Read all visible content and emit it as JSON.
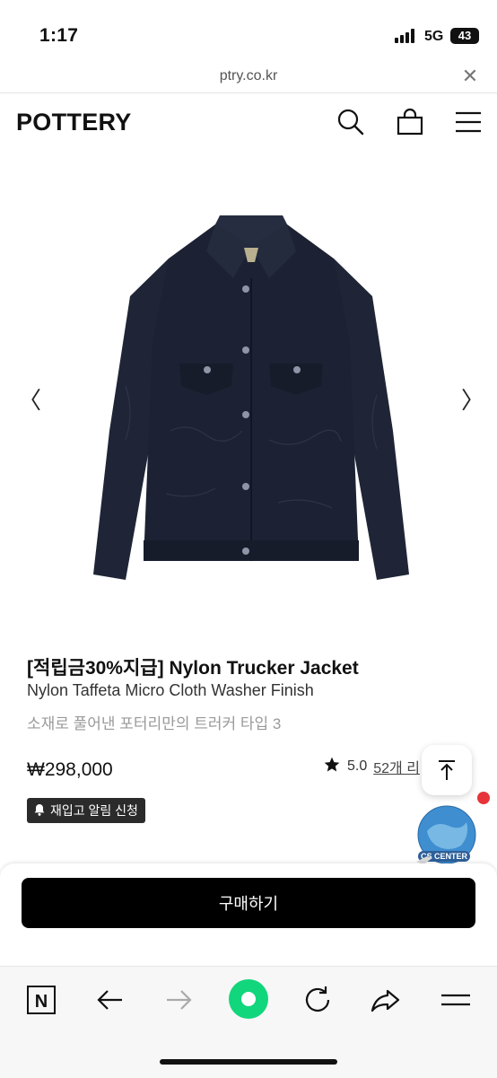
{
  "status_bar": {
    "time": "1:17",
    "network": "5G",
    "battery": "43"
  },
  "browser": {
    "url": "ptry.co.kr"
  },
  "site": {
    "logo": "POTTERY"
  },
  "header_icons": [
    "search-icon",
    "shopping-bag-icon",
    "menu-icon"
  ],
  "product": {
    "title": "[적립금30%지급] Nylon Trucker Jacket",
    "subtitle": "Nylon Taffeta Micro Cloth Washer Finish",
    "description": "소재로 풀어낸 포터리만의 트러커 타입 3",
    "price": "₩298,000",
    "rating": "5.0",
    "reviews": "52개 리",
    "restock_label": "재입고 알림 신청",
    "buy_label": "구매하기",
    "image_color": "#1c2233"
  },
  "carousel": {
    "prev_symbol": "〈",
    "next_symbol": "〉"
  },
  "widgets": {
    "cs_label": "CS CENTER",
    "notification_color": "#e6343a"
  },
  "bottom_bar": {
    "n_label": "N",
    "accent": "#11d67c"
  },
  "colors": {
    "primary_button": "#000000",
    "badge_bg": "#2b2b2b"
  }
}
